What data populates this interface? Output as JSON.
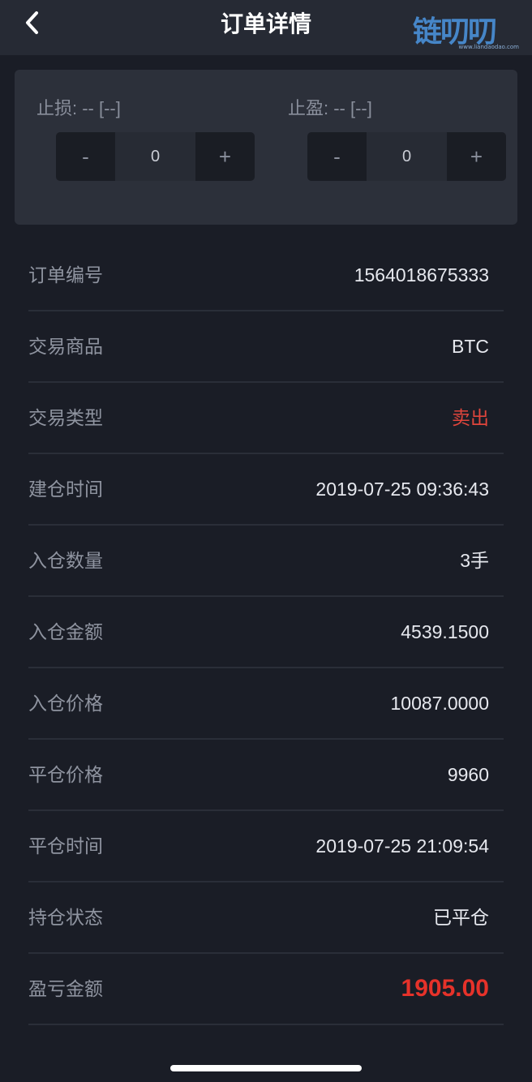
{
  "header": {
    "title": "订单详情",
    "watermark": "链叨叨",
    "watermark_sub": "www.liandaodao.com"
  },
  "stop_loss": {
    "label": "止损: -- [--]",
    "value": "0",
    "minus": "-",
    "plus": "+"
  },
  "take_profit": {
    "label": "止盈: -- [--]",
    "value": "0",
    "minus": "-",
    "plus": "+"
  },
  "rows": [
    {
      "label": "订单编号",
      "value": "1564018675333"
    },
    {
      "label": "交易商品",
      "value": "BTC"
    },
    {
      "label": "交易类型",
      "value": "卖出"
    },
    {
      "label": "建仓时间",
      "value": "2019-07-25 09:36:43"
    },
    {
      "label": "入仓数量",
      "value": "3手"
    },
    {
      "label": "入仓金额",
      "value": "4539.1500"
    },
    {
      "label": "入仓价格",
      "value": "10087.0000"
    },
    {
      "label": "平仓价格",
      "value": "9960"
    },
    {
      "label": "平仓时间",
      "value": "2019-07-25 21:09:54"
    },
    {
      "label": "持仓状态",
      "value": "已平仓"
    },
    {
      "label": "盈亏金额",
      "value": "1905.00"
    }
  ],
  "colors": {
    "background": "#1a1d26",
    "header": "#262a34",
    "panel": "#2c303a",
    "sell_red": "#e0453c",
    "profit_red": "#e6322a"
  },
  "icons": {
    "back": "chevron-left-icon"
  }
}
